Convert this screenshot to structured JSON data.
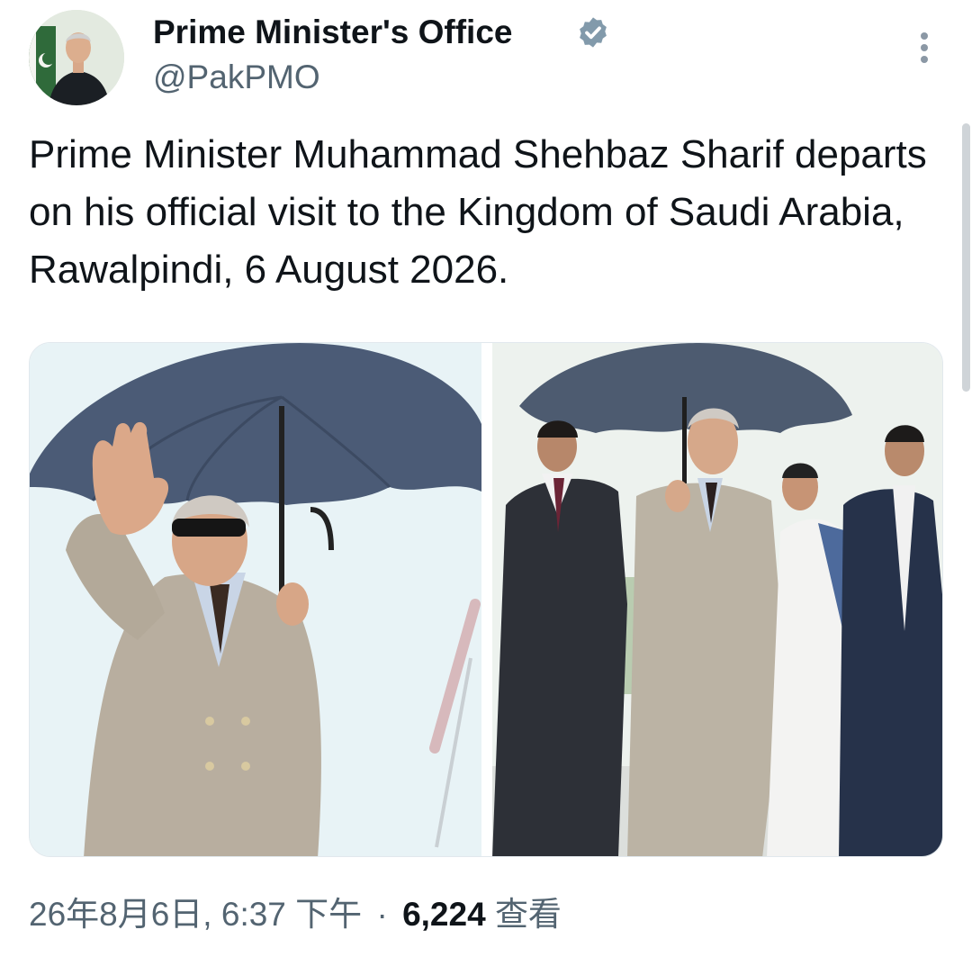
{
  "author": {
    "name": "Prime Minister's Office",
    "handle": "@PakPMO",
    "avatar_icon": "avatar-photo",
    "verified_icon": "verified-badge-icon",
    "verified_color": "#829aab"
  },
  "menu": {
    "more_icon": "more-vertical-icon"
  },
  "tweet": {
    "text": "Prime Minister Muhammad Shehbaz Sharif departs on his official visit to the Kingdom of Saudi Arabia, Rawalpindi, 6 August 2026."
  },
  "media": [
    {
      "name": "photo-waving-under-umbrella"
    },
    {
      "name": "photo-walking-with-entourage"
    }
  ],
  "meta": {
    "timestamp": "26年8月6日, 6:37 下午",
    "separator": "·",
    "views_count": "6,224",
    "views_label": "查看"
  },
  "colors": {
    "text_primary": "#0f1419",
    "text_secondary": "#536471",
    "umbrella": "#4a5a74",
    "suit": "#b7ad9f"
  }
}
